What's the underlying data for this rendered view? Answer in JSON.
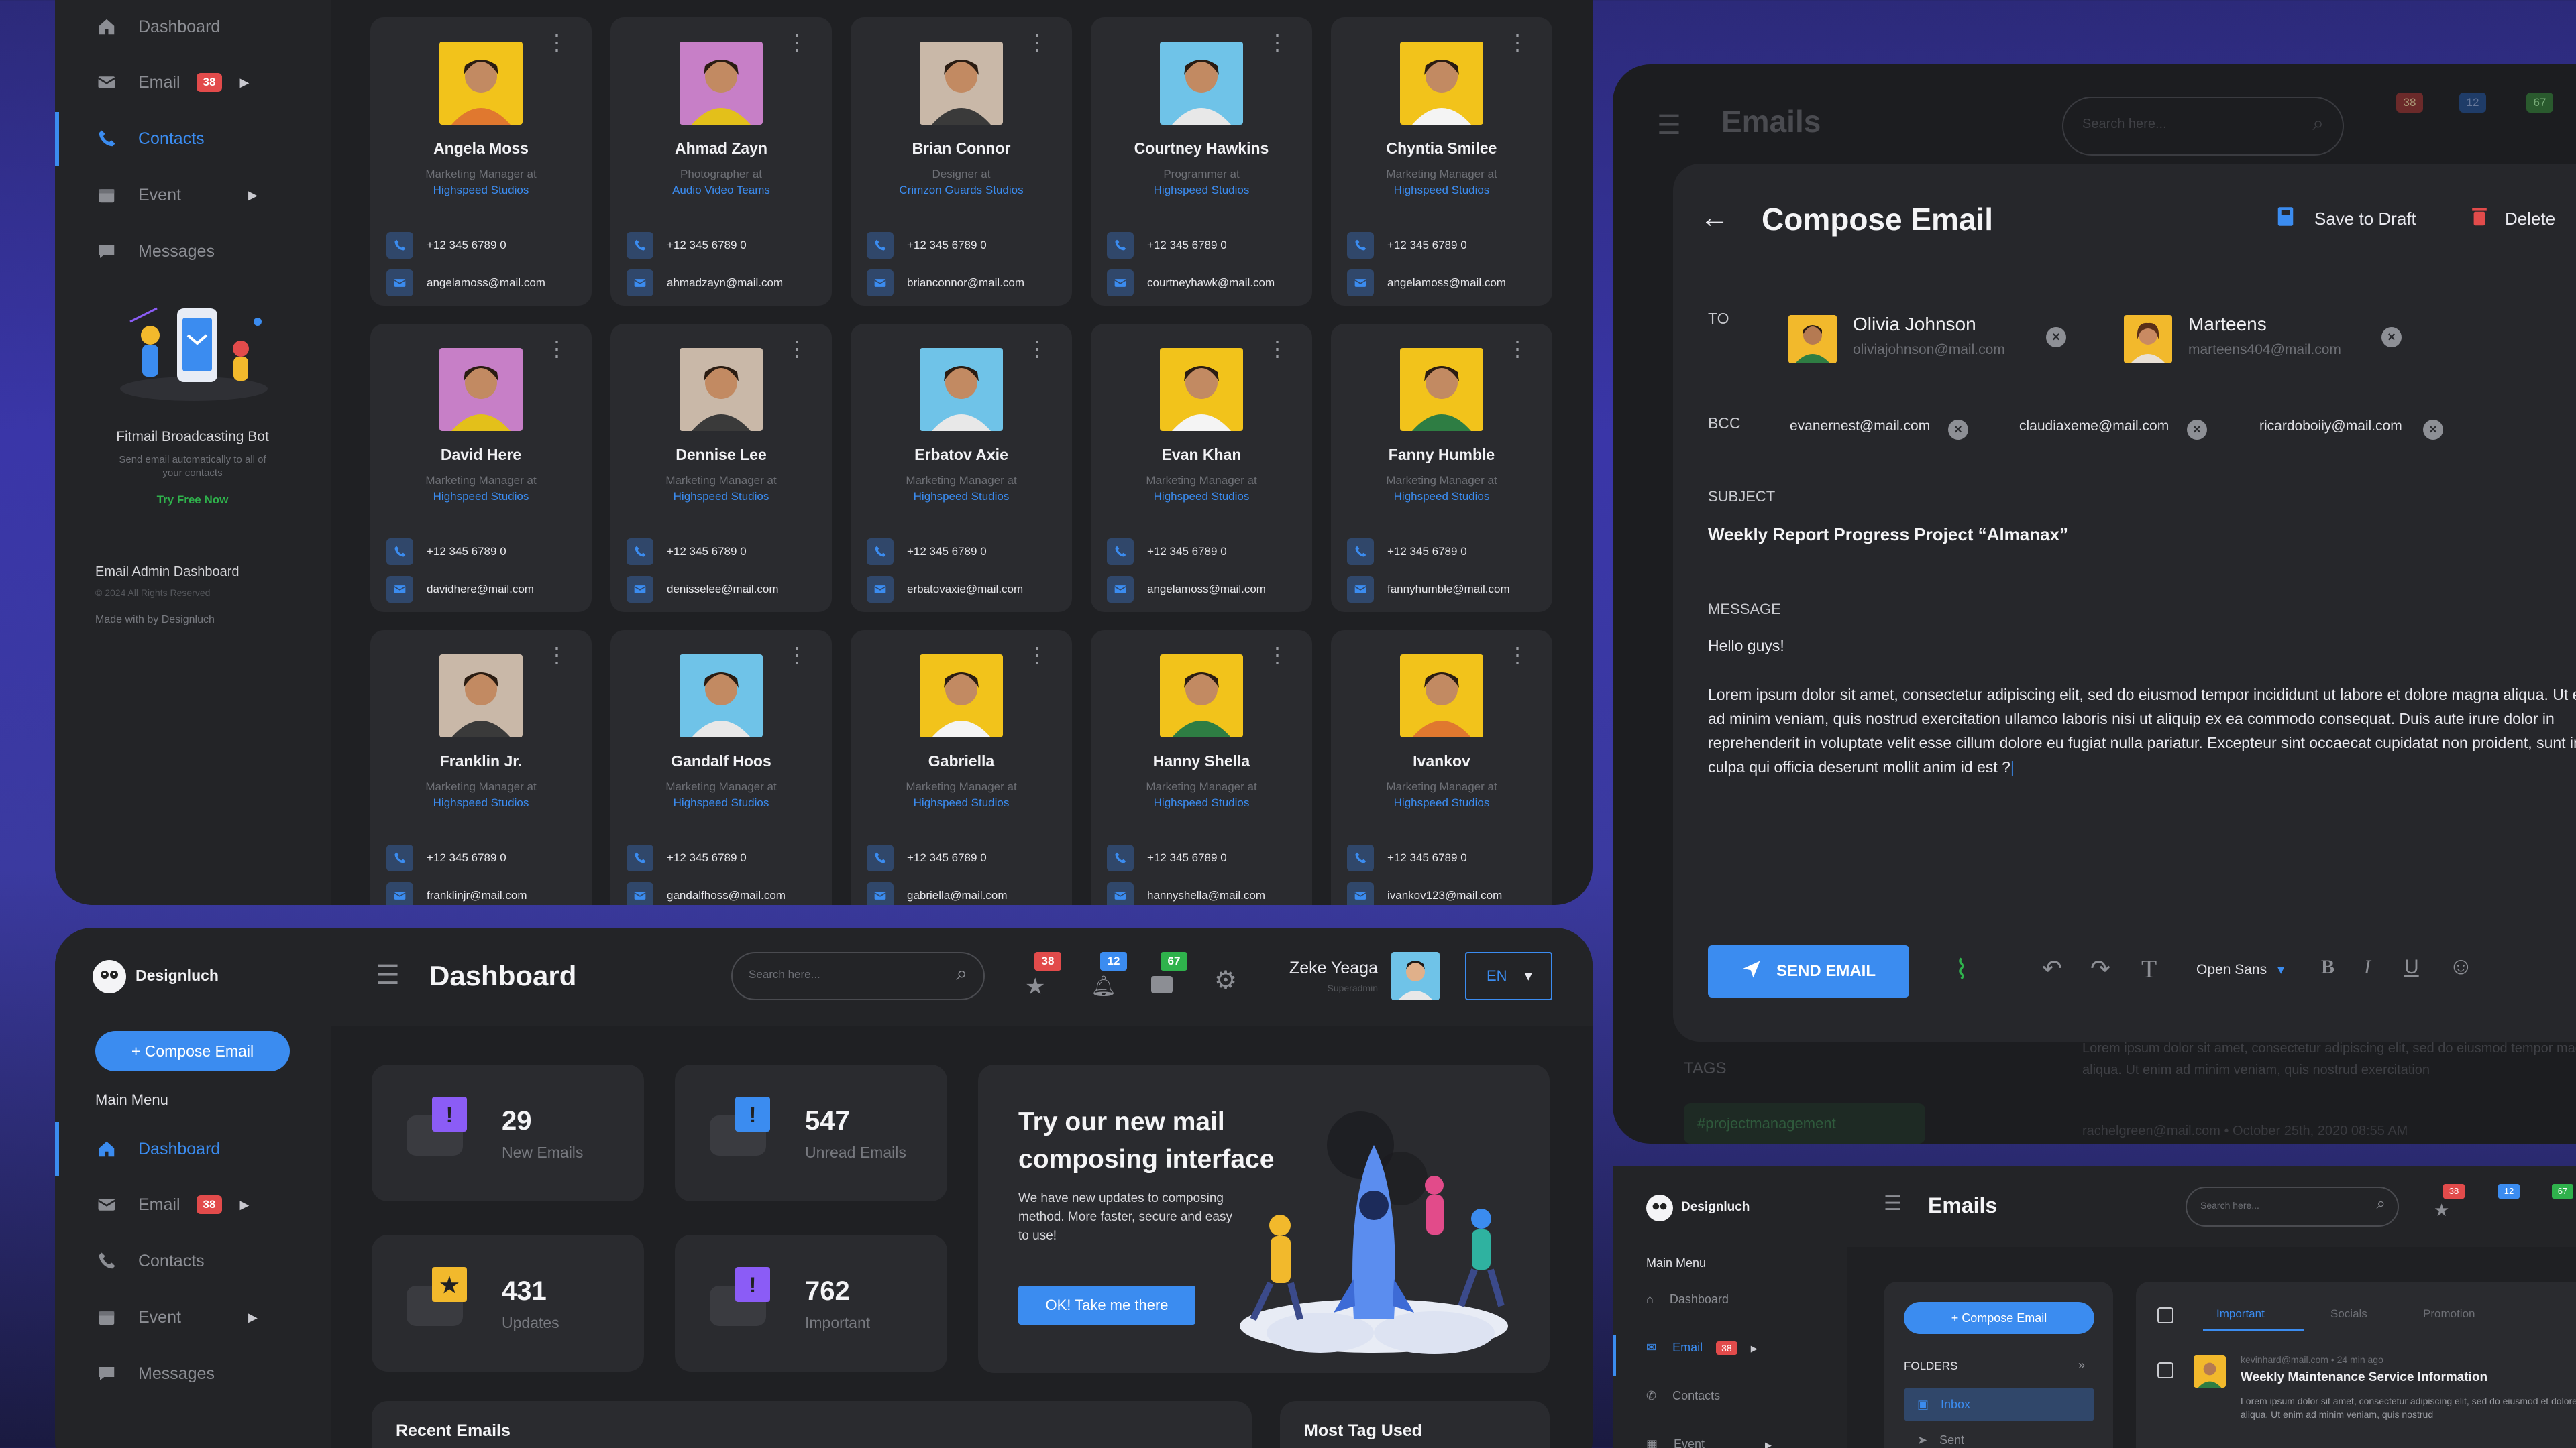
{
  "sidebar_top": {
    "nav": [
      {
        "label": "Dashboard"
      },
      {
        "label": "Email",
        "badge": "38"
      },
      {
        "label": "Contacts"
      },
      {
        "label": "Event"
      },
      {
        "label": "Messages"
      }
    ],
    "promo_title": "Fitmail Broadcasting Bot",
    "promo_text": "Send email automatically to all of your contacts",
    "promo_cta": "Try Free Now",
    "footer_title": "Email Admin Dashboard",
    "footer_copy": "© 2024 All Rights Reserved",
    "footer_made": "Made with by Designluch"
  },
  "contacts": [
    {
      "name": "Angela Moss",
      "role": "Marketing Manager at",
      "company": "Highspeed Studios",
      "phone": "+12 345 6789 0",
      "email": "angelamoss@mail.com",
      "bg": "#f2c31b",
      "shirt": "#e0782f"
    },
    {
      "name": "Ahmad Zayn",
      "role": "Photographer at",
      "company": "Audio Video Teams",
      "phone": "+12 345 6789 0",
      "email": "ahmadzayn@mail.com",
      "bg": "#c77fc7",
      "shirt": "#e3c01a"
    },
    {
      "name": "Brian Connor",
      "role": "Designer at",
      "company": "Crimzon Guards Studios",
      "phone": "+12 345 6789 0",
      "email": "brianconnor@mail.com",
      "bg": "#c9b8a8",
      "shirt": "#3a3a3a"
    },
    {
      "name": "Courtney Hawkins",
      "role": "Programmer at",
      "company": "Highspeed Studios",
      "phone": "+12 345 6789 0",
      "email": "courtneyhawk@mail.com",
      "bg": "#6fc3e8",
      "shirt": "#e8e8e8"
    },
    {
      "name": "Chyntia Smilee",
      "role": "Marketing Manager at",
      "company": "Highspeed Studios",
      "phone": "+12 345 6789 0",
      "email": "angelamoss@mail.com",
      "bg": "#f2c31b",
      "shirt": "#f4f4f4"
    },
    {
      "name": "David Here",
      "role": "Marketing Manager at",
      "company": "Highspeed Studios",
      "phone": "+12 345 6789 0",
      "email": "davidhere@mail.com",
      "bg": "#c77fc7",
      "shirt": "#e3c01a"
    },
    {
      "name": "Dennise Lee",
      "role": "Marketing Manager at",
      "company": "Highspeed Studios",
      "phone": "+12 345 6789 0",
      "email": "denisselee@mail.com",
      "bg": "#c9b8a8",
      "shirt": "#3a3a3a"
    },
    {
      "name": "Erbatov Axie",
      "role": "Marketing Manager at",
      "company": "Highspeed Studios",
      "phone": "+12 345 6789 0",
      "email": "erbatovaxie@mail.com",
      "bg": "#6fc3e8",
      "shirt": "#e8e8e8"
    },
    {
      "name": "Evan Khan",
      "role": "Marketing Manager at",
      "company": "Highspeed Studios",
      "phone": "+12 345 6789 0",
      "email": "angelamoss@mail.com",
      "bg": "#f2c31b",
      "shirt": "#f4f4f4"
    },
    {
      "name": "Fanny Humble",
      "role": "Marketing Manager at",
      "company": "Highspeed Studios",
      "phone": "+12 345 6789 0",
      "email": "fannyhumble@mail.com",
      "bg": "#f2c31b",
      "shirt": "#2e7d43"
    },
    {
      "name": "Franklin Jr.",
      "role": "Marketing Manager at",
      "company": "Highspeed Studios",
      "phone": "+12 345 6789 0",
      "email": "franklinjr@mail.com",
      "bg": "#c9b8a8",
      "shirt": "#3a3a3a"
    },
    {
      "name": "Gandalf Hoos",
      "role": "Marketing Manager at",
      "company": "Highspeed Studios",
      "phone": "+12 345 6789 0",
      "email": "gandalfhoss@mail.com",
      "bg": "#6fc3e8",
      "shirt": "#e8e8e8"
    },
    {
      "name": "Gabriella",
      "role": "Marketing Manager at",
      "company": "Highspeed Studios",
      "phone": "+12 345 6789 0",
      "email": "gabriella@mail.com",
      "bg": "#f2c31b",
      "shirt": "#f4f4f4"
    },
    {
      "name": "Hanny Shella",
      "role": "Marketing Manager at",
      "company": "Highspeed Studios",
      "phone": "+12 345 6789 0",
      "email": "hannyshella@mail.com",
      "bg": "#f2c31b",
      "shirt": "#2e7d43"
    },
    {
      "name": "Ivankov",
      "role": "Marketing Manager at",
      "company": "Highspeed Studios",
      "phone": "+12 345 6789 0",
      "email": "ivankov123@mail.com",
      "bg": "#f2c31b",
      "shirt": "#e0782f"
    }
  ],
  "emails_panel": {
    "title": "Emails",
    "search_placeholder": "Search here...",
    "badges": [
      "38",
      "12",
      "67"
    ],
    "tags_label": "TAGS",
    "tag": "#projectmanagement",
    "preview_text": "Lorem ipsum dolor sit amet, consectetur adipiscing elit, sed do eiusmod tempor magna aliqua. Ut enim ad minim veniam, quis nostrud exercitation",
    "preview_meta": "rachelgreen@mail.com • October 25th, 2020  08:55 AM"
  },
  "compose": {
    "title": "Compose Email",
    "save_draft": "Save to Draft",
    "delete": "Delete",
    "to_label": "TO",
    "recipients": [
      {
        "name": "Olivia Johnson",
        "email": "oliviajohnson@mail.com"
      },
      {
        "name": "Marteens",
        "email": "marteens404@mail.com"
      }
    ],
    "bcc_label": "BCC",
    "bcc": [
      "evanernest@mail.com",
      "claudiaxeme@mail.com",
      "ricardoboiiy@mail.com"
    ],
    "subject_label": "SUBJECT",
    "subject": "Weekly Report Progress Project “Almanax”",
    "message_label": "MESSAGE",
    "greeting": "Hello guys!",
    "body": "Lorem ipsum dolor sit amet, consectetur adipiscing elit, sed do eiusmod tempor incididunt ut labore et dolore magna aliqua. Ut enim ad minim veniam, quis nostrud exercitation ullamco laboris nisi ut aliquip ex ea commodo consequat. Duis aute irure dolor in reprehenderit in voluptate velit esse cillum dolore eu fugiat nulla pariatur. Excepteur sint occaecat cupidatat non proident, sunt in culpa qui officia deserunt mollit anim id est ?",
    "send_label": "SEND EMAIL",
    "font_select": "Open Sans"
  },
  "dashboard": {
    "brand": "Designluch",
    "compose_btn": "+ Compose Email",
    "main_menu": "Main Menu",
    "nav": [
      {
        "label": "Dashboard"
      },
      {
        "label": "Email",
        "badge": "38"
      },
      {
        "label": "Contacts"
      },
      {
        "label": "Event"
      },
      {
        "label": "Messages"
      }
    ],
    "title": "Dashboard",
    "search_placeholder": "Search here...",
    "badges": [
      "38",
      "12",
      "67"
    ],
    "user_name": "Zeke Yeaga",
    "user_role": "Superadmin",
    "lang": "EN",
    "stats": [
      {
        "num": "29",
        "label": "New Emails",
        "color": "#8b5cf6"
      },
      {
        "num": "547",
        "label": "Unread Emails",
        "color": "#3b8cf0"
      },
      {
        "num": "431",
        "label": "Updates",
        "color": "#f2b92c"
      },
      {
        "num": "762",
        "label": "Important",
        "color": "#8b5cf6"
      }
    ],
    "promo_title": "Try our new mail composing interface",
    "promo_text": "We have new updates to composing method. More faster, secure and easy to use!",
    "promo_btn": "OK! Take me there",
    "recent_label": "Recent Emails",
    "tag_label": "Most Tag Used"
  },
  "emails_small": {
    "brand": "Designluch",
    "title": "Emails",
    "search_placeholder": "Search here...",
    "badges": [
      "38",
      "12",
      "67"
    ],
    "main_menu": "Main Menu",
    "nav": [
      {
        "label": "Dashboard"
      },
      {
        "label": "Email",
        "badge": "38"
      },
      {
        "label": "Contacts"
      },
      {
        "label": "Event"
      }
    ],
    "compose_btn": "+ Compose Email",
    "folders_label": "FOLDERS",
    "folders": [
      "Inbox",
      "Sent"
    ],
    "tabs": [
      "Important",
      "Socials",
      "Promotion"
    ],
    "mail_meta": "kevinhard@mail.com  •  24 min ago",
    "mail_subject": "Weekly Maintenance Service Information",
    "mail_preview": "Lorem ipsum dolor sit amet, consectetur adipiscing elit, sed do eiusmod et dolore magna aliqua. Ut enim ad minim veniam, quis nostrud"
  }
}
